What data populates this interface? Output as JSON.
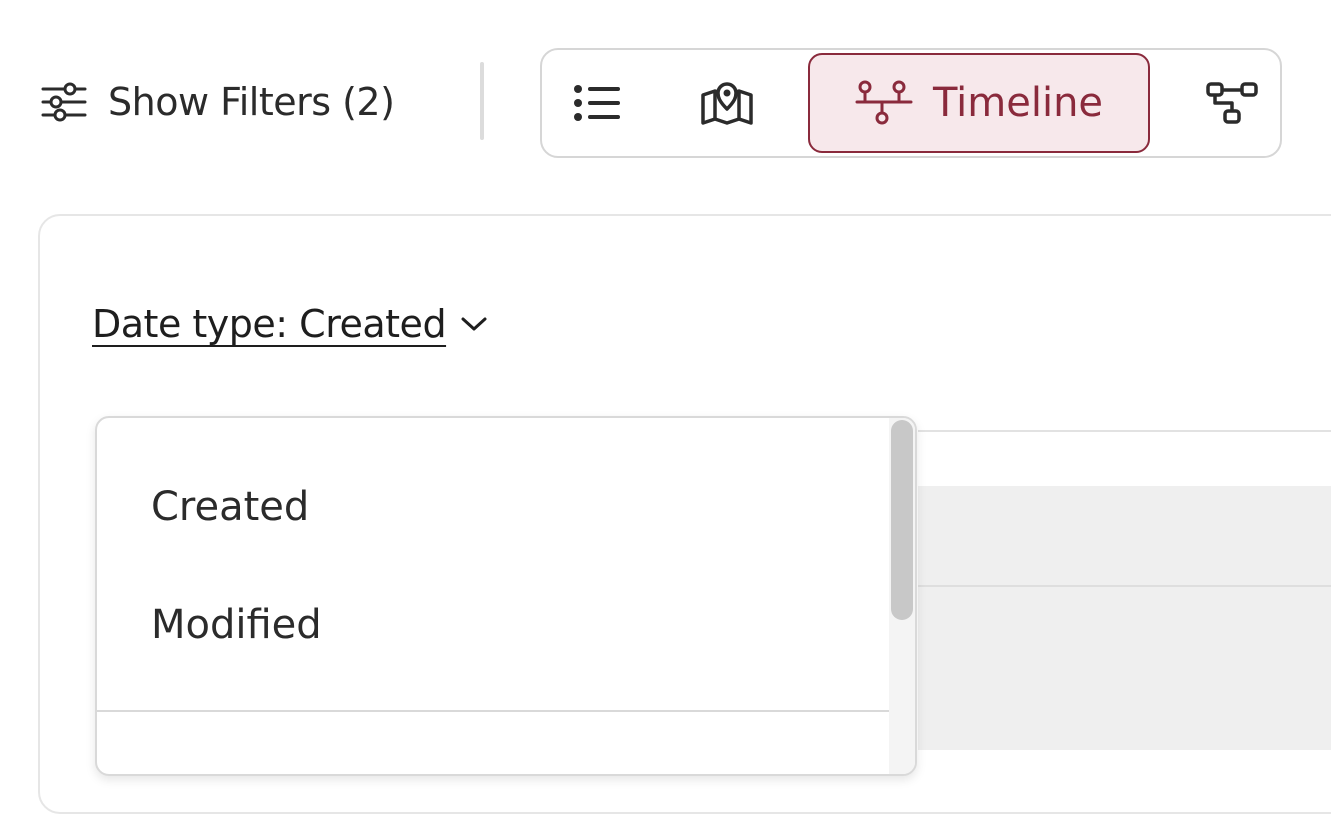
{
  "toolbar": {
    "filters_label": "Show Filters (2)",
    "views": [
      {
        "name": "list",
        "icon": "list-icon",
        "label": ""
      },
      {
        "name": "map",
        "icon": "map-pin-icon",
        "label": ""
      },
      {
        "name": "timeline",
        "icon": "timeline-icon",
        "label": "Timeline",
        "selected": true
      },
      {
        "name": "network",
        "icon": "network-icon",
        "label": ""
      }
    ]
  },
  "panel": {
    "date_type_label": "Date type: Created"
  },
  "dropdown": {
    "options": [
      "Created",
      "Modified"
    ]
  },
  "colors": {
    "accent": "#8a2a3c",
    "accent_bg": "#f7e8eb",
    "text": "#2b2b2b",
    "border": "#d6d6d6"
  }
}
